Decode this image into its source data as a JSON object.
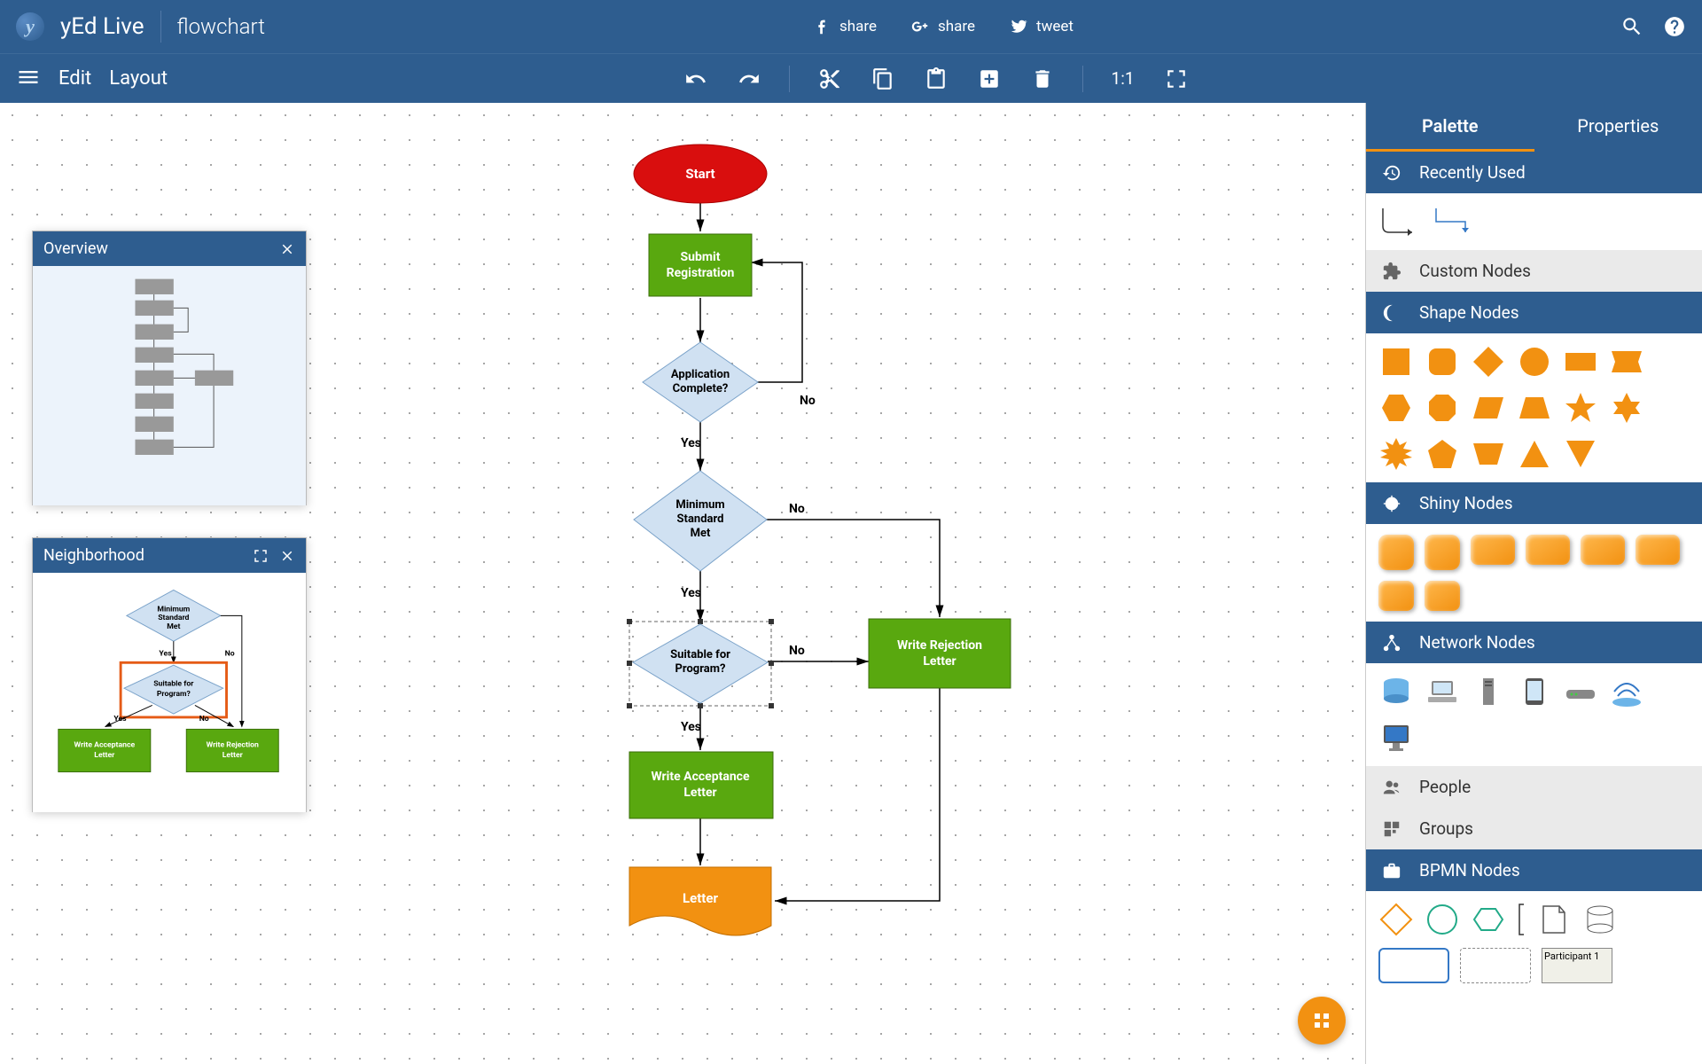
{
  "app": {
    "name": "yEd Live",
    "document": "flowchart"
  },
  "share": {
    "fb": "share",
    "gp": "share",
    "tw": "tweet"
  },
  "menu": {
    "edit": "Edit",
    "layout": "Layout",
    "ratio": "1:1"
  },
  "panels": {
    "overview": "Overview",
    "neighborhood": "Neighborhood"
  },
  "sideTabs": {
    "palette": "Palette",
    "properties": "Properties"
  },
  "sections": {
    "recent": "Recently Used",
    "custom": "Custom Nodes",
    "shape": "Shape Nodes",
    "shiny": "Shiny Nodes",
    "network": "Network Nodes",
    "people": "People",
    "groups": "Groups",
    "bpmn": "BPMN Nodes"
  },
  "flow": {
    "start": "Start",
    "submit": "Submit Registration",
    "complete": "Application Complete?",
    "yes": "Yes",
    "no": "No",
    "minstd": "Minimum Standard Met",
    "suitable": "Suitable for Program?",
    "accept": "Write Acceptance Letter",
    "reject": "Write Rejection Letter",
    "letter": "Letter"
  },
  "nh": {
    "accept": "Write Acceptance Letter",
    "reject": "Write Rejection Letter"
  },
  "bpmn": {
    "participant": "Participant 1"
  }
}
